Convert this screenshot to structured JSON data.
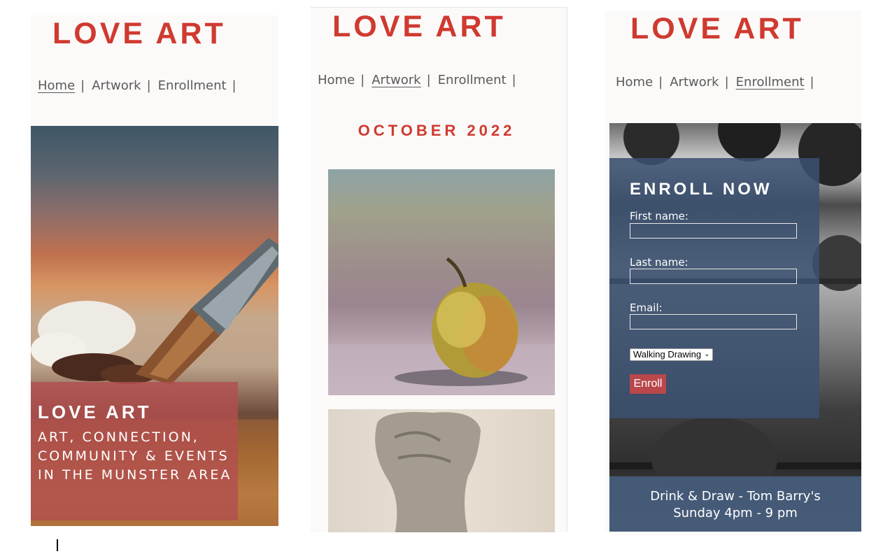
{
  "screens": [
    {
      "logo": "LOVE ART",
      "nav": [
        {
          "label": "Home",
          "active": true
        },
        {
          "label": "Artwork",
          "active": false
        },
        {
          "label": "Enrollment",
          "active": false
        }
      ],
      "separator": "|",
      "hero_caption": {
        "title": "LOVE ART",
        "subtitle": "ART, CONNECTION, COMMUNITY & EVENTS IN THE MUNSTER AREA"
      }
    },
    {
      "logo": "LOVE ART",
      "nav": [
        {
          "label": "Home",
          "active": false
        },
        {
          "label": "Artwork",
          "active": true
        },
        {
          "label": "Enrollment",
          "active": false
        }
      ],
      "separator": "|",
      "month_heading": "OCTOBER 2022"
    },
    {
      "logo": "LOVE ART",
      "nav": [
        {
          "label": "Home",
          "active": false
        },
        {
          "label": "Artwork",
          "active": false
        },
        {
          "label": "Enrollment",
          "active": true
        }
      ],
      "separator": "|",
      "form": {
        "title": "ENROLL NOW",
        "first_name_label": "First name:",
        "last_name_label": "Last name:",
        "email_label": "Email:",
        "class_select_value": "Walking Drawing",
        "submit_label": "Enroll"
      },
      "footer": {
        "line1": "Drink & Draw - Tom Barry's",
        "line2": "Sunday 4pm - 9 pm"
      }
    }
  ],
  "colors": {
    "brand_red": "#cf3a30",
    "caption_overlay": "#b24e4e",
    "form_overlay": "#3a5070",
    "button": "#b9474b"
  }
}
